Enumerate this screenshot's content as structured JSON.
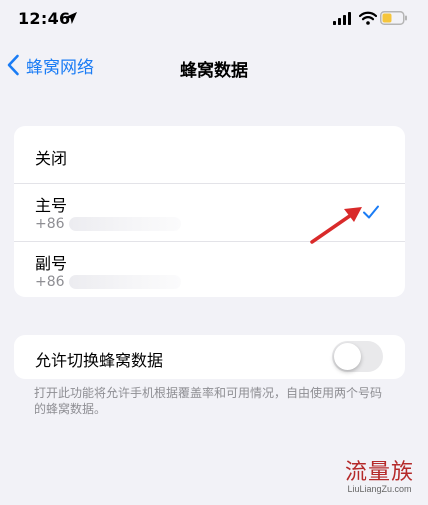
{
  "status_bar": {
    "time": "12:46"
  },
  "nav": {
    "back_label": "蜂窝网络",
    "title": "蜂窝数据"
  },
  "sim_options": [
    {
      "label": "关闭"
    },
    {
      "label": "主号",
      "number_prefix": "+86",
      "selected": true
    },
    {
      "label": "副号",
      "number_prefix": "+86",
      "selected": false
    }
  ],
  "switching": {
    "label": "允许切换蜂窝数据",
    "enabled": false
  },
  "footer_note": "打开此功能将允许手机根据覆盖率和可用情况，自由使用两个号码的蜂窝数据。",
  "watermark": {
    "logo": "流量族",
    "url": "LiuLiangZu.com"
  },
  "colors": {
    "accent": "#1a7cf5",
    "background": "#f2f2f7",
    "annotation_arrow": "#d92a2a",
    "battery": "#f5c53c"
  },
  "icons": [
    "location-arrow-icon",
    "signal-bars-icon",
    "wifi-icon",
    "battery-icon",
    "chevron-left-icon",
    "checkmark-icon"
  ]
}
